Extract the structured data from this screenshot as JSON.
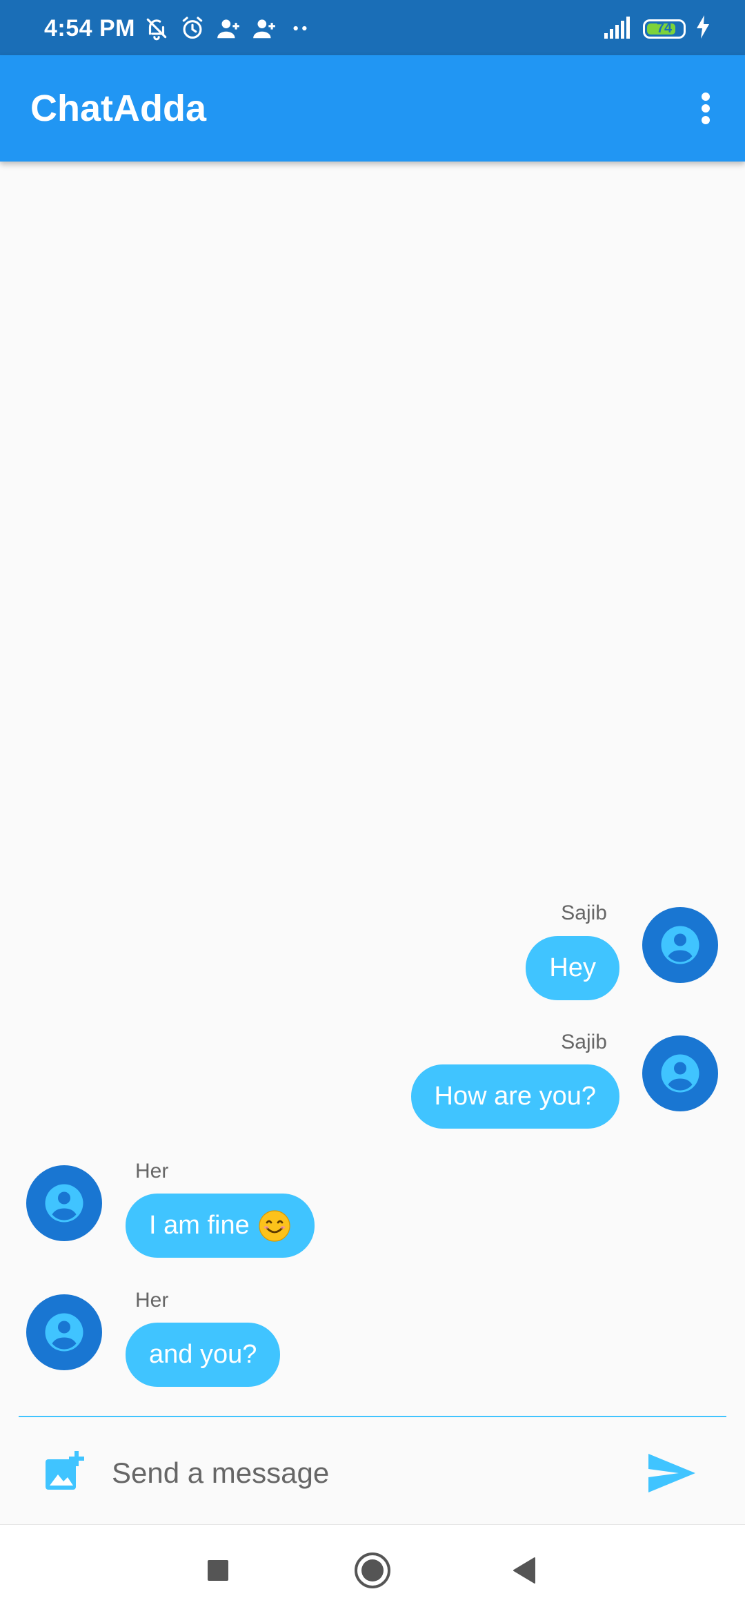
{
  "status_bar": {
    "time": "4:54 PM",
    "battery_level": "74",
    "colors": {
      "background": "#1a6eb7",
      "battery_fill": "#7dd33b"
    },
    "icons": [
      "bell-off-icon",
      "alarm-icon",
      "person-add-icon",
      "person-add-icon",
      "more-dots-icon",
      "signal-icon",
      "battery-icon",
      "charging-icon"
    ]
  },
  "app_bar": {
    "title": "ChatAdda",
    "menu_icon": "more-vert-icon",
    "colors": {
      "background": "#2196f3"
    }
  },
  "messages": [
    {
      "sender": "Sajib",
      "text": "Hey",
      "side": "right"
    },
    {
      "sender": "Sajib",
      "text": "How are you?",
      "side": "right"
    },
    {
      "sender": "Her",
      "text": "I am fine",
      "emoji": "smiling-face-emoji",
      "side": "left"
    },
    {
      "sender": "Her",
      "text": "and you?",
      "side": "left"
    }
  ],
  "colors": {
    "bubble": "#40c4ff",
    "avatar": "#1976d2",
    "avatar_icon": "#40c4ff",
    "accent": "#40c4ff"
  },
  "composer": {
    "placeholder": "Send a message",
    "value": "",
    "attach_icon": "add-photo-icon",
    "send_icon": "send-icon"
  },
  "nav_bar": {
    "icons": [
      "recents-square-icon",
      "home-circle-icon",
      "back-triangle-icon"
    ]
  }
}
